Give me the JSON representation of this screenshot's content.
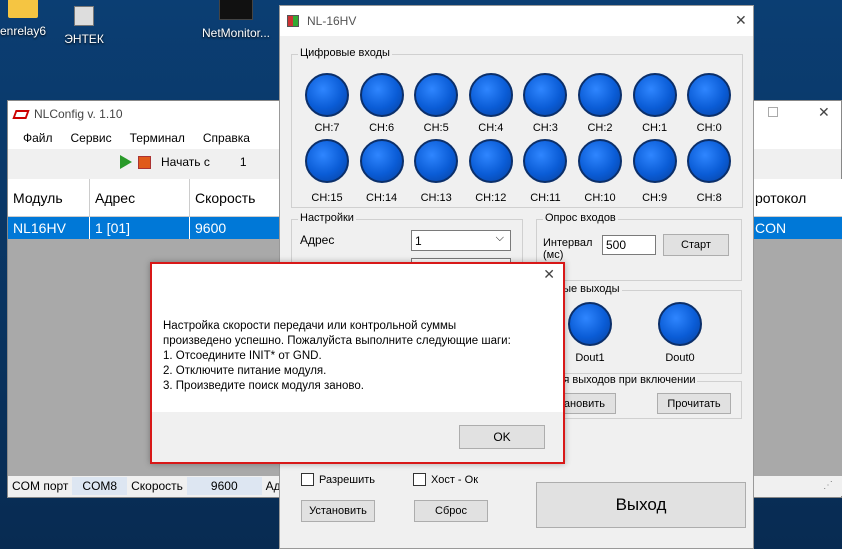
{
  "desktop": {
    "icons": [
      {
        "label": "enrelay6",
        "icon": "folder-icon"
      },
      {
        "label": "ЭНТЕК",
        "icon": "shortcut-icon"
      },
      {
        "label": "NetMonitor...",
        "icon": "netmonitor-icon"
      }
    ]
  },
  "nlconfig": {
    "title": "NLConfig v. 1.10",
    "menu": [
      "Файл",
      "Сервис",
      "Терминал",
      "Справка"
    ],
    "toolbar": {
      "start_label": "Начать с",
      "start_value": "1"
    },
    "grid": {
      "headers": [
        "Модуль",
        "Адрес",
        "Скорость",
        "ротокол"
      ],
      "row": [
        "NL16HV",
        "1 [01]",
        "9600",
        "CON"
      ]
    },
    "status": {
      "com_label": "COM порт",
      "com_value": "COM8",
      "speed_label": "Скорость",
      "speed_value": "9600",
      "addr_label": "Адре"
    }
  },
  "hv": {
    "title": "NL-16HV",
    "digital_inputs_label": "Цифровые входы",
    "channels_row1": [
      "CH:7",
      "CH:6",
      "CH:5",
      "CH:4",
      "CH:3",
      "CH:2",
      "CH:1",
      "CH:0"
    ],
    "channels_row2": [
      "CH:15",
      "CH:14",
      "CH:13",
      "CH:12",
      "CH:11",
      "CH:10",
      "CH:9",
      "CH:8"
    ],
    "settings_label": "Настройки",
    "address_label": "Адрес",
    "address_value": "1",
    "poll_label": "Опрос входов",
    "interval_label": "Интервал (мс)",
    "interval_value": "500",
    "start_button": "Старт",
    "outputs_label": "ровые выходы",
    "outputs": [
      "Dout1",
      "Dout0"
    ],
    "power_on_label": "ения выходов при включении",
    "set_partial": "тановить",
    "read_button": "Прочитать",
    "allow_label": "Разрешить",
    "host_ok_label": "Хост - Ок",
    "set_button": "Установить",
    "reset_button": "Сброс",
    "exit_button": "Выход"
  },
  "dialog": {
    "lines": [
      "Настройка скорости передачи или контрольной суммы",
      "произведено успешно. Пожалуйста выполните следующие шаги:",
      "1. Отсоедините INIT* от GND.",
      "2. Отключите питание модуля.",
      "3. Произведите поиск модуля заново."
    ],
    "ok_label": "OK",
    "close_glyph": "✕"
  }
}
